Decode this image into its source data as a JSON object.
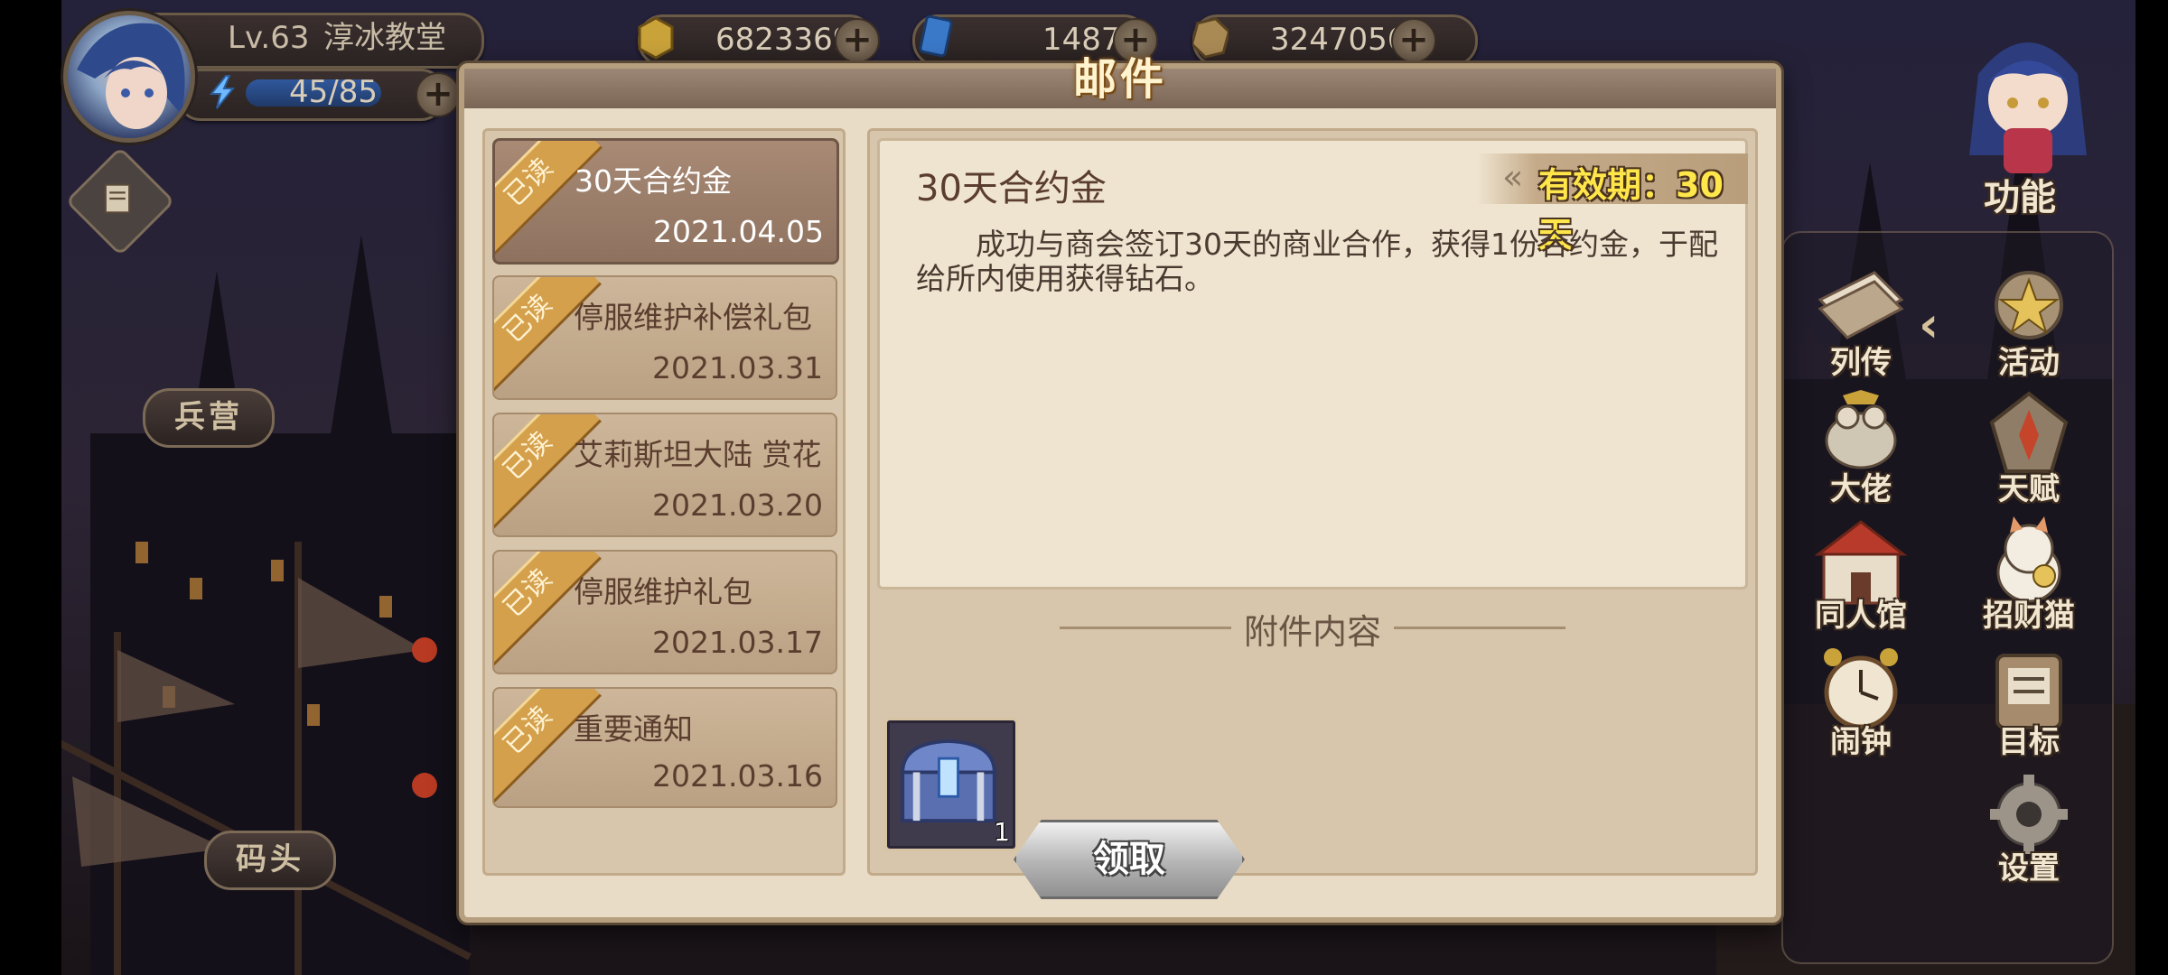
{
  "player": {
    "level": "Lv.63",
    "name": "淳冰教堂",
    "stamina": "45/85"
  },
  "resources": [
    {
      "icon": "gold-coin-icon",
      "value": "6823369"
    },
    {
      "icon": "blue-card-icon",
      "value": "1487"
    },
    {
      "icon": "bronze-coin-icon",
      "value": "3247056"
    }
  ],
  "left_nav": {
    "barracks": "兵营",
    "dock": "码头"
  },
  "right_panel": {
    "function_label": "功能",
    "items": [
      {
        "label": "列传",
        "icon": "scroll-icon"
      },
      {
        "label": "活动",
        "icon": "star-badge-icon"
      },
      {
        "label": "大佬",
        "icon": "boss-frog-icon"
      },
      {
        "label": "天赋",
        "icon": "talent-emblem-icon"
      },
      {
        "label": "同人馆",
        "icon": "gallery-hall-icon"
      },
      {
        "label": "招财猫",
        "icon": "lucky-cat-icon"
      },
      {
        "label": "闹钟",
        "icon": "alarm-clock-icon"
      },
      {
        "label": "目标",
        "icon": "target-board-icon"
      },
      {
        "label": "设置",
        "icon": "gear-icon"
      }
    ]
  },
  "mail": {
    "title": "邮件",
    "read_label": "已读",
    "list": [
      {
        "title": "30天合约金",
        "date": "2021.04.05"
      },
      {
        "title": "停服维护补偿礼包",
        "date": "2021.03.31"
      },
      {
        "title": "艾莉斯坦大陆 赏花",
        "date": "2021.03.20"
      },
      {
        "title": "停服维护礼包",
        "date": "2021.03.17"
      },
      {
        "title": "重要通知",
        "date": "2021.03.16"
      }
    ],
    "selected": {
      "subject": "30天合约金",
      "validity": "有效期：30天",
      "body": "成功与商会签订30天的商业合作，获得1份合约金，于配给所内使用获得钻石。"
    },
    "attachments_title": "附件内容",
    "attachment": {
      "icon": "treasure-chest-icon",
      "qty": "1"
    },
    "claim_label": "领取"
  }
}
